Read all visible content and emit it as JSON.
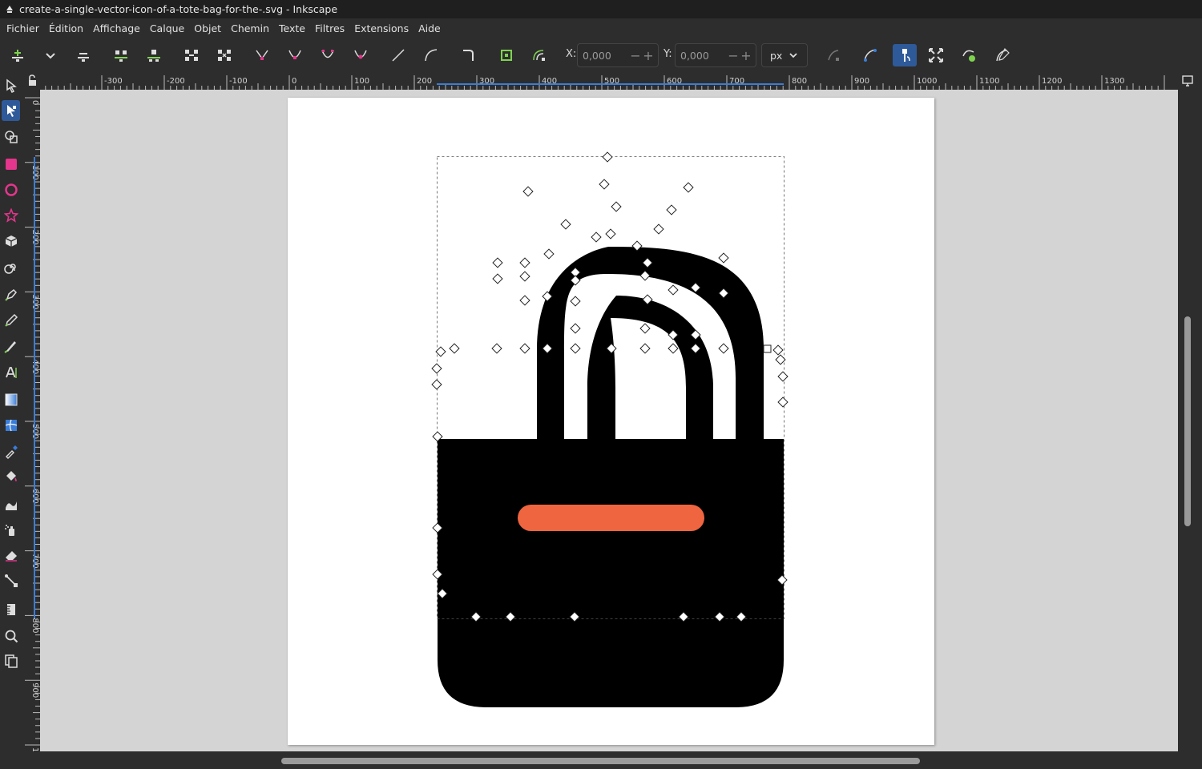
{
  "window": {
    "title": "create-a-single-vector-icon-of-a-tote-bag-for-the-.svg - Inkscape"
  },
  "menu": [
    {
      "label": "Fichier"
    },
    {
      "label": "Édition"
    },
    {
      "label": "Affichage"
    },
    {
      "label": "Calque"
    },
    {
      "label": "Objet"
    },
    {
      "label": "Chemin"
    },
    {
      "label": "Texte"
    },
    {
      "label": "Filtres"
    },
    {
      "label": "Extensions"
    },
    {
      "label": "Aide"
    }
  ],
  "toolbar": {
    "x_label": "X:",
    "x_value": "0,000",
    "y_label": "Y:",
    "y_value": "0,000",
    "unit": "px",
    "minus": "−",
    "plus": "+"
  },
  "ruler_h": [
    "-300",
    "-200",
    "-100",
    "0",
    "100",
    "200",
    "300",
    "400",
    "500",
    "600",
    "700",
    "800",
    "900",
    "1000",
    "1100",
    "1200",
    "1300"
  ],
  "ruler_v": [
    "0",
    "100",
    "200",
    "300",
    "400",
    "500",
    "600",
    "700",
    "800",
    "900",
    "1000"
  ],
  "colors": {
    "accent": "#2f5a9a",
    "bag": "#000000",
    "label_strip": "#ee6540",
    "node_add": "#7ed24f",
    "node_break": "#e3368c"
  },
  "tools": [
    "selector-tool",
    "node-tool",
    "shape-builder-tool",
    "rectangle-tool",
    "ellipse-tool",
    "star-tool",
    "box3d-tool",
    "spiral-tool",
    "pen-tool",
    "pencil-tool",
    "calligraphy-tool",
    "text-tool",
    "gradient-tool",
    "mesh-tool",
    "dropper-tool",
    "paint-bucket-tool",
    "tweak-tool",
    "spray-tool",
    "eraser-tool",
    "connector-tool",
    "measure-tool",
    "zoom-tool",
    "pages-tool"
  ]
}
